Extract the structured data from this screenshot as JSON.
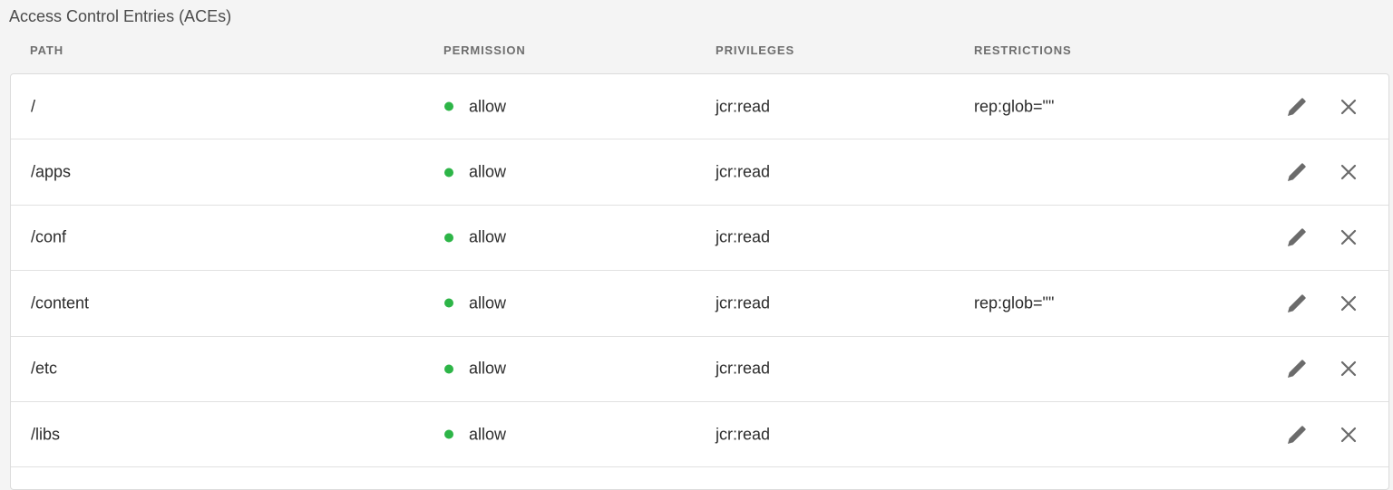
{
  "page": {
    "title": "Access Control Entries (ACEs)"
  },
  "columns": {
    "path": "PATH",
    "permission": "PERMISSION",
    "privileges": "PRIVILEGES",
    "restrictions": "RESTRICTIONS"
  },
  "colors": {
    "allow_status": "#2db547",
    "icon": "#6b6b6b"
  },
  "rows": [
    {
      "path": "/",
      "permission": "allow",
      "privileges": "jcr:read",
      "restrictions": "rep:glob=\"\"",
      "edit_icon": "pencil-icon",
      "delete_icon": "close-icon"
    },
    {
      "path": "/apps",
      "permission": "allow",
      "privileges": "jcr:read",
      "restrictions": "",
      "edit_icon": "pencil-icon",
      "delete_icon": "close-icon"
    },
    {
      "path": "/conf",
      "permission": "allow",
      "privileges": "jcr:read",
      "restrictions": "",
      "edit_icon": "pencil-icon",
      "delete_icon": "close-icon"
    },
    {
      "path": "/content",
      "permission": "allow",
      "privileges": "jcr:read",
      "restrictions": "rep:glob=\"\"",
      "edit_icon": "pencil-icon",
      "delete_icon": "close-icon"
    },
    {
      "path": "/etc",
      "permission": "allow",
      "privileges": "jcr:read",
      "restrictions": "",
      "edit_icon": "pencil-icon",
      "delete_icon": "close-icon"
    },
    {
      "path": "/libs",
      "permission": "allow",
      "privileges": "jcr:read",
      "restrictions": "",
      "edit_icon": "pencil-icon",
      "delete_icon": "close-icon"
    }
  ]
}
